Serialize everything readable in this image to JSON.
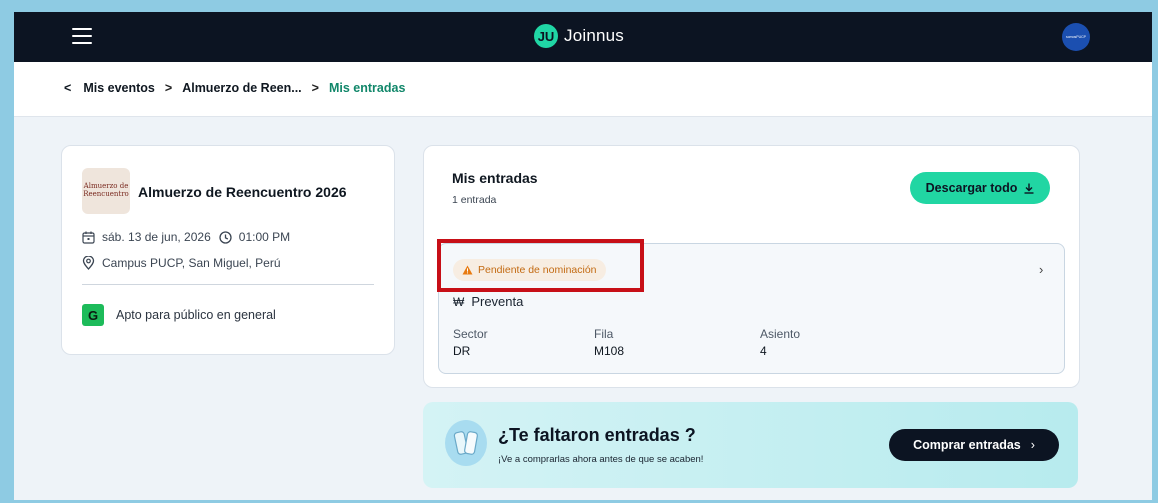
{
  "header": {
    "logo_text": "Joinnus",
    "avatar_text": "somosPUCP"
  },
  "breadcrumb": {
    "back": "<",
    "items": [
      "Mis eventos",
      "Almuerzo de Reen...",
      "Mis entradas"
    ],
    "separator": ">"
  },
  "event": {
    "thumb_text": "Almuerzo de Reencuentro",
    "title": "Almuerzo de Reencuentro 2026",
    "date": "sáb. 13 de jun, 2026",
    "time": "01:00 PM",
    "location": "Campus PUCP, San Miguel, Perú",
    "rating_letter": "G",
    "rating_text": "Apto para público en general"
  },
  "tickets": {
    "title": "Mis entradas",
    "count": "1 entrada",
    "download_label": "Descargar todo",
    "download_icon": "download-icon",
    "ticket": {
      "status": "Pendiente de nominación",
      "status_color": "#c36a12",
      "type_icon": "₩",
      "type": "Preventa",
      "sector_label": "Sector",
      "sector_value": "DR",
      "row_label": "Fila",
      "row_value": "M108",
      "seat_label": "Asiento",
      "seat_value": "4"
    }
  },
  "banner": {
    "title": "¿Te faltaron entradas ?",
    "subtitle": "¡Ve a comprarlas ahora antes de que se acaben!",
    "button_label": "Comprar entradas"
  },
  "colors": {
    "accent": "#21d6a3",
    "header_bg": "#0c1422",
    "highlight": "#c70f17"
  }
}
